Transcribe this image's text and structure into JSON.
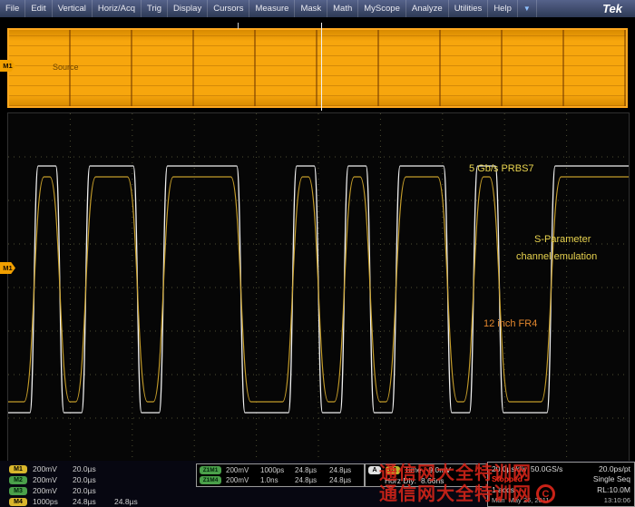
{
  "menu": {
    "items": [
      "File",
      "Edit",
      "Vertical",
      "Horiz/Acq",
      "Trig",
      "Display",
      "Cursors",
      "Measure",
      "Mask",
      "Math",
      "MyScope",
      "Analyze",
      "Utilities",
      "Help"
    ],
    "dropdown_icon": "▼",
    "logo": "Tek"
  },
  "overview": {
    "source_label": "Source",
    "marker_label": "M1"
  },
  "main": {
    "marker_label": "M1"
  },
  "annotations": {
    "bitrate": "5 Gb/s PRBS7",
    "sparam1": "S-Parameter",
    "sparam2": "channel emulation",
    "fr4": "12 inch FR4"
  },
  "channels": [
    {
      "badge": "M1",
      "v1": "200mV",
      "v2": "20.0µs",
      "v3": ""
    },
    {
      "badge": "M2",
      "v1": "200mV",
      "v2": "20.0µs",
      "v3": ""
    },
    {
      "badge": "M3",
      "v1": "200mV",
      "v2": "20.0µs",
      "v3": ""
    },
    {
      "badge": "M4",
      "v1": "1000ps",
      "v2": "24.8µs",
      "v3": "24.8µs"
    }
  ],
  "zoom": [
    {
      "badge": "Z1M1",
      "v1": "200mV",
      "v2": "1000ps",
      "v3": "24.8µs",
      "v4": "24.8µs"
    },
    {
      "badge": "Z1M4",
      "v1": "200mV",
      "v2": "1.0ns",
      "v3": "24.8µs",
      "v4": "24.8µs"
    }
  ],
  "trigger": {
    "a": "A",
    "source": "C1",
    "type": "Time",
    "level": "-9.0mV",
    "dly_label": "Horz Dly:",
    "dly_value": "8.66ns"
  },
  "horizontal": {
    "scale": "20.0µs/div",
    "rate": "50.0GS/s",
    "res": "20.0ps/pt",
    "status": "Stopped",
    "mode": "Single Seq",
    "acqs": "1 acqs",
    "record": "RL:10.0M",
    "trig_mode": "Man",
    "date": "May 26, 2011",
    "time": "13:10:06"
  },
  "watermark": {
    "line1": "通信网大全特训网",
    "line2": "通信网大全特训网",
    "circle": "C"
  },
  "waveform": {
    "bits": [
      0,
      1,
      0,
      1,
      1,
      0,
      1,
      1,
      1,
      0,
      0,
      1,
      0,
      1,
      0,
      1,
      1,
      0,
      1,
      0,
      0,
      1,
      1,
      1
    ],
    "white_color": "#f0f0f0",
    "yellow_color": "#cfa42c"
  },
  "colors": {
    "accent_orange": "#f2a000",
    "menu_bg": "#3c4a66",
    "status_red": "#ff2a1a",
    "grid": "#4d4d33"
  }
}
